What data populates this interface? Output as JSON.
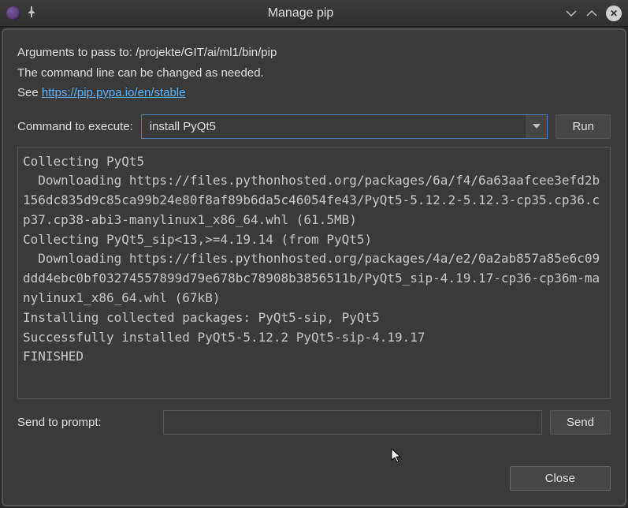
{
  "window": {
    "title": "Manage pip"
  },
  "info": {
    "line1_prefix": "Arguments to pass to: ",
    "pip_path": "/projekte/GIT/ai/ml1/bin/pip",
    "line2": "The command line can be changed as needed.",
    "see_prefix": "See ",
    "link_text": "https://pip.pypa.io/en/stable"
  },
  "cmd": {
    "label": "Command to execute:",
    "value": "install PyQt5",
    "run_label": "Run"
  },
  "output_text": "Collecting PyQt5\n  Downloading https://files.pythonhosted.org/packages/6a/f4/6a63aafcee3efd2b156dc835d9c85ca99b24e80f8af89b6da5c46054fe43/PyQt5-5.12.2-5.12.3-cp35.cp36.cp37.cp38-abi3-manylinux1_x86_64.whl (61.5MB)\nCollecting PyQt5_sip<13,>=4.19.14 (from PyQt5)\n  Downloading https://files.pythonhosted.org/packages/4a/e2/0a2ab857a85e6c09ddd4ebc0bf03274557899d79e678bc78908b3856511b/PyQt5_sip-4.19.17-cp36-cp36m-manylinux1_x86_64.whl (67kB)\nInstalling collected packages: PyQt5-sip, PyQt5\nSuccessfully installed PyQt5-5.12.2 PyQt5-sip-4.19.17\nFINISHED",
  "prompt": {
    "label": "Send to prompt:",
    "value": "",
    "send_label": "Send"
  },
  "footer": {
    "close_label": "Close"
  }
}
